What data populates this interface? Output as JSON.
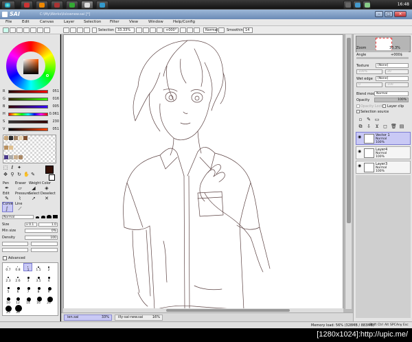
{
  "taskbar": {
    "clock": "16:48"
  },
  "window": {
    "app_title": "SAI",
    "path": "C:\\My\\Works\\ilslownew.sai [*]"
  },
  "menu": [
    {
      "label": "File"
    },
    {
      "label": "Edit"
    },
    {
      "label": "Canvas"
    },
    {
      "label": "Layer"
    },
    {
      "label": "Selection"
    },
    {
      "label": "Filter"
    },
    {
      "label": "View"
    },
    {
      "label": "Window"
    },
    {
      "label": "Help/Config"
    }
  ],
  "toolbar": {
    "selection_label": "Selection",
    "zoom": "33.33%",
    "rotation": "+000°",
    "blend_mode": "Normal",
    "smoothing_label": "Smoothing",
    "smoothing_value": "14"
  },
  "color_sliders": [
    {
      "label": "R",
      "value": "051",
      "color": "#ff0000"
    },
    {
      "label": "G",
      "value": "016",
      "color": "#00c000"
    },
    {
      "label": "B",
      "value": "005",
      "color": "#0000ff"
    },
    {
      "label": "H",
      "value": "0.061",
      "color": "#ff8000"
    },
    {
      "label": "S",
      "value": "230",
      "color": "#ff4000"
    },
    {
      "label": "V",
      "value": "051",
      "color": "#808080"
    }
  ],
  "tools": {
    "row1": [
      "Pen",
      "Eraser",
      "Weight",
      "Color"
    ],
    "row2": [
      "Edit",
      "Pressure",
      "Select",
      "Deselect"
    ],
    "row3": [
      "Curve",
      "Line"
    ]
  },
  "brush": {
    "mode": "Normal",
    "size_label": "Size",
    "size_mult": "x 0.1",
    "size_value": "1.0",
    "min_size_label": "Min size",
    "min_size_value": "0%",
    "density_label": "Density",
    "density_value": "100",
    "advanced_label": "Advanced",
    "size_presets": [
      "0.7",
      "0.8",
      "1",
      "1.5",
      "2",
      "2.3",
      "2.6",
      "3",
      "3.5",
      "4",
      "5",
      "6",
      "7",
      "8",
      "9",
      "10",
      "12",
      "14",
      "16",
      "20",
      "25",
      "30"
    ]
  },
  "navigator": {
    "zoom_label": "Zoom",
    "zoom_value": "33.3%",
    "angle_label": "Angle",
    "angle_value": "+000$"
  },
  "texture": {
    "texture_label": "Texture",
    "texture_value": "[None]",
    "scale_label": "Scale",
    "scale_value": "100%",
    "scale2": "20",
    "wet_edge_label": "Wet edge",
    "wet_edge_value": "[None]",
    "size_label": "Size",
    "size_value": "0",
    "fine_label": "Fine",
    "fine_value": "100"
  },
  "layer_props": {
    "blend_label": "Blend mode",
    "blend_value": "Normal",
    "opacity_label": "Opacity",
    "opacity_value": "100%",
    "protect_label": "Opacity Lock",
    "clip_label": "Layer clip",
    "selsrc_label": "Selection source"
  },
  "layers": [
    {
      "name": "Vector 1",
      "mode": "Normal",
      "opacity": "100%",
      "selected": true
    },
    {
      "name": "Layer4",
      "mode": "Normal",
      "opacity": "100%",
      "selected": false
    },
    {
      "name": "Layer3",
      "mode": "Normal",
      "opacity": "100%",
      "selected": false
    }
  ],
  "doc_tabs": [
    {
      "name": "ien.sai",
      "zoom": "33%"
    },
    {
      "name": "illy-sai-new.sai",
      "zoom": "16%"
    }
  ],
  "status": {
    "memory": "Memory load: 56% (328MB / 883MB)",
    "keys": [
      "Shift",
      "Ctrl",
      "Alt",
      "SPC",
      "Any",
      "Esc"
    ]
  },
  "watermark": "[1280x1024]:http://upic.me/"
}
